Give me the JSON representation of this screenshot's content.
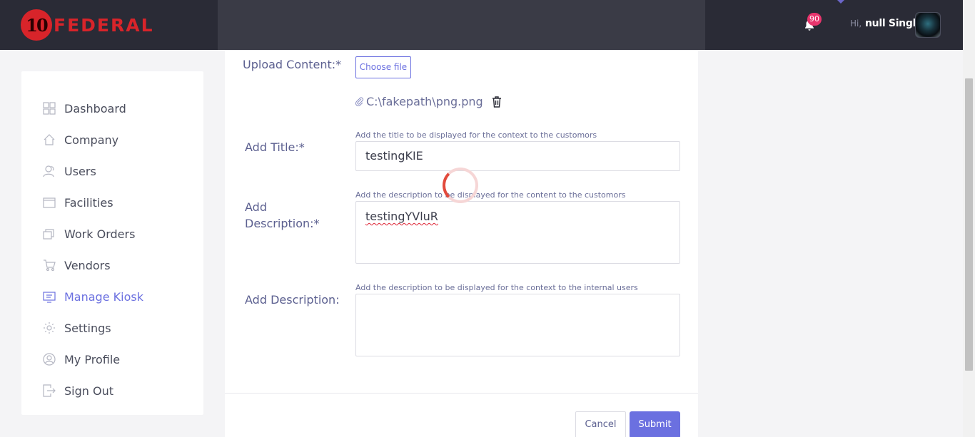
{
  "header": {
    "logo_number": "10",
    "logo_text": "FEDERAL",
    "notification_count": "90",
    "greeting": "Hi,",
    "user_name": "null Singh"
  },
  "sidebar": {
    "items": [
      {
        "label": "Dashboard",
        "icon": "dashboard-icon"
      },
      {
        "label": "Company",
        "icon": "home-icon"
      },
      {
        "label": "Users",
        "icon": "users-icon"
      },
      {
        "label": "Facilities",
        "icon": "facilities-icon"
      },
      {
        "label": "Work Orders",
        "icon": "work-orders-icon"
      },
      {
        "label": "Vendors",
        "icon": "cart-icon"
      },
      {
        "label": "Manage Kiosk",
        "icon": "kiosk-icon",
        "active": true
      },
      {
        "label": "Settings",
        "icon": "gear-icon"
      },
      {
        "label": "My Profile",
        "icon": "profile-icon"
      },
      {
        "label": "Sign Out",
        "icon": "sign-out-icon"
      }
    ]
  },
  "form": {
    "upload_label": "Upload Content:*",
    "choose_file": "Choose file",
    "file_path": "C:\\fakepath\\png.png",
    "title_label": "Add Title:*",
    "title_hint": "Add the title to be displayed for the context to the customors",
    "title_value": "testingKIE",
    "desc_label_1": "Add",
    "desc_label_2": "Description:*",
    "desc_hint": "Add the description to be displayed for the content to the customors",
    "desc_value": "testingYVluR",
    "internal_label": "Add Description:",
    "internal_hint": "Add the description to be displayed for the context to the internal users",
    "internal_value": "",
    "cancel": "Cancel",
    "submit": "Submit"
  },
  "colors": {
    "accent": "#6b70e0",
    "header_bg": "#2a2b36",
    "brand_red": "#d8242a",
    "badge": "#e8356d"
  }
}
